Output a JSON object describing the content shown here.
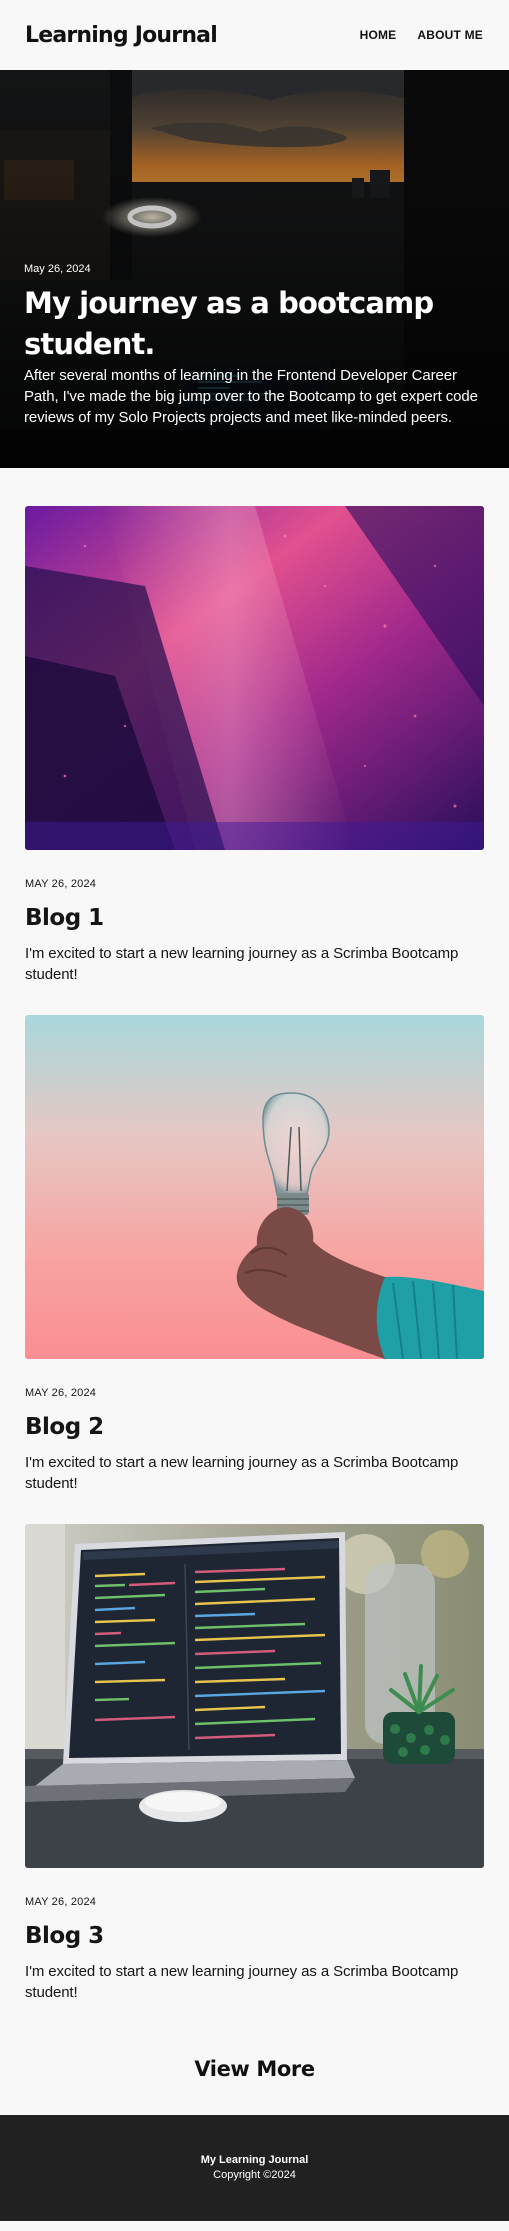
{
  "header": {
    "logo": "Learning Journal",
    "nav": [
      {
        "label": "HOME"
      },
      {
        "label": "ABOUT ME"
      }
    ]
  },
  "hero": {
    "date": "May 26, 2024",
    "title": "My journey as a bootcamp student.",
    "description": "After several months of learning in the Frontend Developer Career Path, I've made the big jump over to the Bootcamp to get expert code reviews of my Solo Projects projects and meet like-minded peers."
  },
  "posts": [
    {
      "date": "MAY 26, 2024",
      "title": "Blog 1",
      "description": "I'm excited to start a new learning journey as a Scrimba Bootcamp student!"
    },
    {
      "date": "MAY 26, 2024",
      "title": "Blog 2",
      "description": "I'm excited to start a new learning journey as a Scrimba Bootcamp student!"
    },
    {
      "date": "MAY 26, 2024",
      "title": "Blog 3",
      "description": "I'm excited to start a new learning journey as a Scrimba Bootcamp student!"
    }
  ],
  "view_more_label": "View More",
  "footer": {
    "title": "My Learning Journal",
    "copyright": "Copyright ©2024"
  },
  "colors": {
    "background": "#f8f8f8",
    "text": "#151515",
    "footer_bg": "#212121"
  }
}
